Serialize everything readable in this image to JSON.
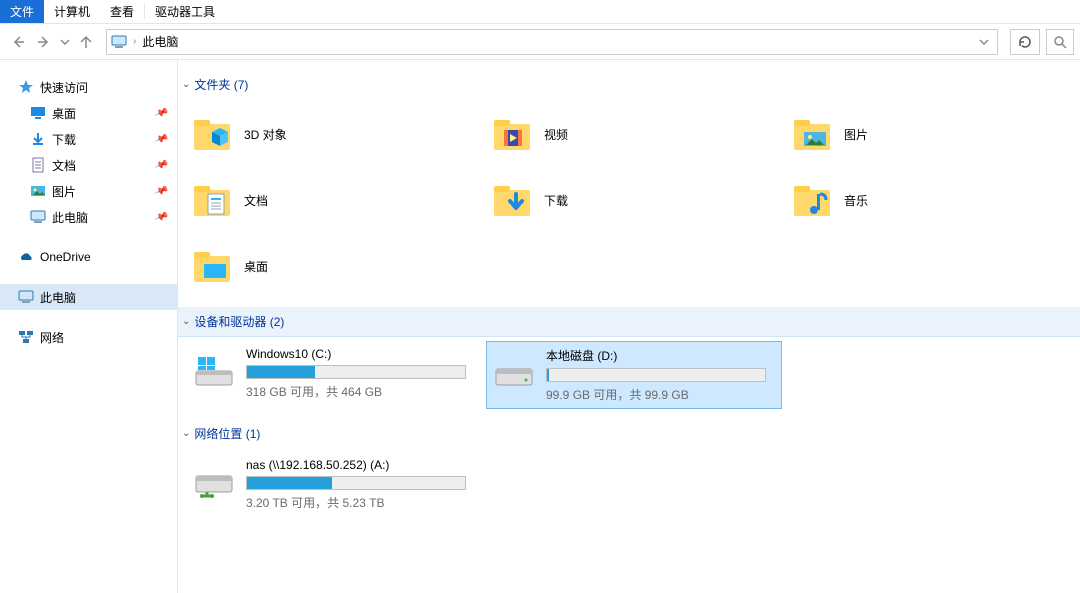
{
  "menu": {
    "file": "文件",
    "computer": "计算机",
    "view": "查看",
    "drivetools": "驱动器工具"
  },
  "nav": {
    "location": "此电脑"
  },
  "sidebar": {
    "quick": "快速访问",
    "desktop": "桌面",
    "downloads": "下载",
    "documents": "文档",
    "pictures": "图片",
    "thispc_pin": "此电脑",
    "onedrive": "OneDrive",
    "thispc": "此电脑",
    "network": "网络"
  },
  "groups": {
    "folders_label": "文件夹 (7)",
    "drives_label": "设备和驱动器 (2)",
    "netloc_label": "网络位置 (1)"
  },
  "folders": {
    "obj3d": "3D 对象",
    "videos": "视频",
    "pictures": "图片",
    "documents": "文档",
    "downloads": "下载",
    "music": "音乐",
    "desktop": "桌面"
  },
  "drives": [
    {
      "title": "Windows10 (C:)",
      "sub": "318 GB 可用，共 464 GB",
      "fill_pct": 31
    },
    {
      "title": "本地磁盘 (D:)",
      "sub": "99.9 GB 可用，共 99.9 GB",
      "fill_pct": 1
    }
  ],
  "netloc": [
    {
      "title": "nas (\\\\192.168.50.252) (A:)",
      "sub": "3.20 TB 可用，共 5.23 TB",
      "fill_pct": 39
    }
  ]
}
